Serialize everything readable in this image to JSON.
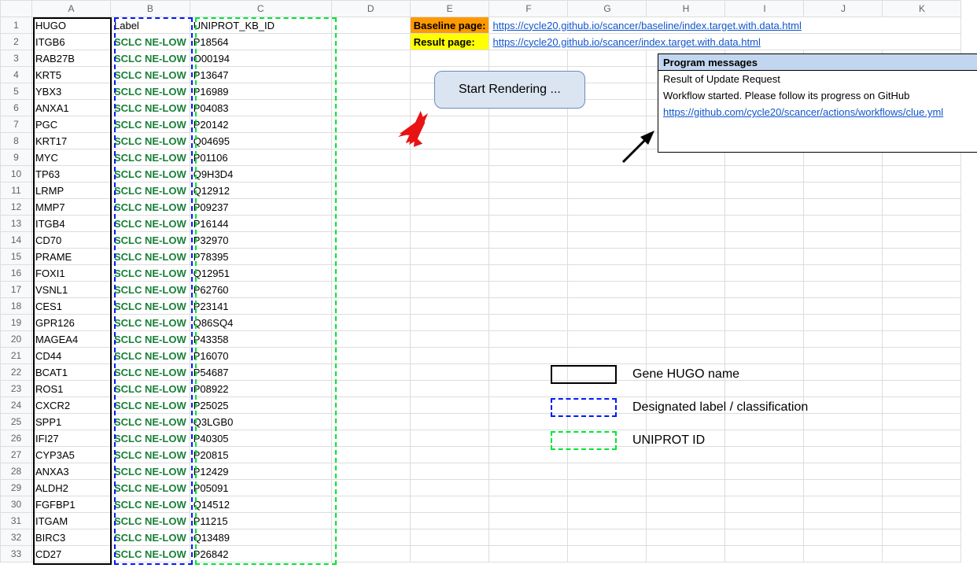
{
  "columns": [
    "",
    "A",
    "B",
    "C",
    "D",
    "E",
    "F",
    "G",
    "H",
    "I",
    "J",
    "K"
  ],
  "headers": {
    "A": "HUGO",
    "B": "Label",
    "C": "UNIPROT_KB_ID"
  },
  "rows": [
    {
      "n": 1,
      "A": "HUGO",
      "B": "Label",
      "C": "UNIPROT_KB_ID"
    },
    {
      "n": 2,
      "A": "ITGB6",
      "B": "SCLC NE-LOW",
      "C": "P18564"
    },
    {
      "n": 3,
      "A": "RAB27B",
      "B": "SCLC NE-LOW",
      "C": "O00194"
    },
    {
      "n": 4,
      "A": "KRT5",
      "B": "SCLC NE-LOW",
      "C": "P13647"
    },
    {
      "n": 5,
      "A": "YBX3",
      "B": "SCLC NE-LOW",
      "C": "P16989"
    },
    {
      "n": 6,
      "A": "ANXA1",
      "B": "SCLC NE-LOW",
      "C": "P04083"
    },
    {
      "n": 7,
      "A": "PGC",
      "B": "SCLC NE-LOW",
      "C": "P20142"
    },
    {
      "n": 8,
      "A": "KRT17",
      "B": "SCLC NE-LOW",
      "C": "Q04695"
    },
    {
      "n": 9,
      "A": "MYC",
      "B": "SCLC NE-LOW",
      "C": "P01106"
    },
    {
      "n": 10,
      "A": "TP63",
      "B": "SCLC NE-LOW",
      "C": "Q9H3D4"
    },
    {
      "n": 11,
      "A": "LRMP",
      "B": "SCLC NE-LOW",
      "C": "Q12912"
    },
    {
      "n": 12,
      "A": "MMP7",
      "B": "SCLC NE-LOW",
      "C": "P09237"
    },
    {
      "n": 13,
      "A": "ITGB4",
      "B": "SCLC NE-LOW",
      "C": "P16144"
    },
    {
      "n": 14,
      "A": "CD70",
      "B": "SCLC NE-LOW",
      "C": "P32970"
    },
    {
      "n": 15,
      "A": "PRAME",
      "B": "SCLC NE-LOW",
      "C": "P78395"
    },
    {
      "n": 16,
      "A": "FOXI1",
      "B": "SCLC NE-LOW",
      "C": "Q12951"
    },
    {
      "n": 17,
      "A": "VSNL1",
      "B": "SCLC NE-LOW",
      "C": "P62760"
    },
    {
      "n": 18,
      "A": "CES1",
      "B": "SCLC NE-LOW",
      "C": "P23141"
    },
    {
      "n": 19,
      "A": "GPR126",
      "B": "SCLC NE-LOW",
      "C": "Q86SQ4"
    },
    {
      "n": 20,
      "A": "MAGEA4",
      "B": "SCLC NE-LOW",
      "C": "P43358"
    },
    {
      "n": 21,
      "A": "CD44",
      "B": "SCLC NE-LOW",
      "C": "P16070"
    },
    {
      "n": 22,
      "A": "BCAT1",
      "B": "SCLC NE-LOW",
      "C": "P54687"
    },
    {
      "n": 23,
      "A": "ROS1",
      "B": "SCLC NE-LOW",
      "C": "P08922"
    },
    {
      "n": 24,
      "A": "CXCR2",
      "B": "SCLC NE-LOW",
      "C": "P25025"
    },
    {
      "n": 25,
      "A": "SPP1",
      "B": "SCLC NE-LOW",
      "C": "Q3LGB0"
    },
    {
      "n": 26,
      "A": "IFI27",
      "B": "SCLC NE-LOW",
      "C": "P40305"
    },
    {
      "n": 27,
      "A": "CYP3A5",
      "B": "SCLC NE-LOW",
      "C": "P20815"
    },
    {
      "n": 28,
      "A": "ANXA3",
      "B": "SCLC NE-LOW",
      "C": "P12429"
    },
    {
      "n": 29,
      "A": "ALDH2",
      "B": "SCLC NE-LOW",
      "C": "P05091"
    },
    {
      "n": 30,
      "A": "FGFBP1",
      "B": "SCLC NE-LOW",
      "C": "Q14512"
    },
    {
      "n": 31,
      "A": "ITGAM",
      "B": "SCLC NE-LOW",
      "C": "P11215"
    },
    {
      "n": 32,
      "A": "BIRC3",
      "B": "SCLC NE-LOW",
      "C": "Q13489"
    },
    {
      "n": 33,
      "A": "CD27",
      "B": "SCLC NE-LOW",
      "C": "P26842"
    }
  ],
  "baseline": {
    "label": "Baseline page:",
    "url": "https://cycle20.github.io/scancer/baseline/index.target.with.data.html"
  },
  "result": {
    "label": "Result page:",
    "url": "https://cycle20.github.io/scancer/index.target.with.data.html"
  },
  "button": "Start Rendering ...",
  "messages": {
    "title": "Program messages",
    "line1": "Result of Update Request",
    "line2": "Workflow started. Please follow its progress on GitHub",
    "link": "https://github.com/cycle20/scancer/actions/workflows/clue.yml"
  },
  "legend": {
    "a": "Gene HUGO name",
    "b": "Designated label / classification",
    "c": "UNIPROT ID"
  }
}
